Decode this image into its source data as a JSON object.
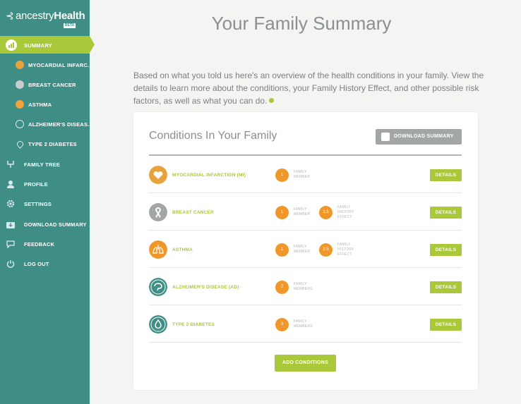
{
  "brand": {
    "name_regular": "ancestry",
    "name_bold": "Health",
    "beta": "BETA"
  },
  "sidebar": {
    "summary": "SUMMARY",
    "sub_items": [
      {
        "label": "MYOCARDIAL INFARC...",
        "icon": "heart-icon",
        "color": "#e8a23b"
      },
      {
        "label": "BREAST CANCER",
        "icon": "ribbon-icon",
        "color": "#a3a6a7"
      },
      {
        "label": "ASTHMA",
        "icon": "lungs-icon",
        "color": "#f0972a"
      },
      {
        "label": "ALZHEIMER'S DISEAS...",
        "icon": "brain-icon",
        "color": "#3f8e86"
      },
      {
        "label": "TYPE 2 DIABETES",
        "icon": "drop-icon",
        "color": "#3f8e86"
      }
    ],
    "items": [
      {
        "label": "FAMILY TREE",
        "icon": "tree-icon"
      },
      {
        "label": "PROFILE",
        "icon": "person-icon"
      },
      {
        "label": "SETTINGS",
        "icon": "gear-icon"
      },
      {
        "label": "DOWNLOAD SUMMARY",
        "icon": "download-icon"
      },
      {
        "label": "FEEDBACK",
        "icon": "chat-icon"
      },
      {
        "label": "LOG OUT",
        "icon": "power-icon"
      }
    ]
  },
  "main": {
    "title": "Your Family Summary",
    "intro": "Based on what you told us here's an overview of the health conditions in your family. View the details to learn more about the conditions, your Family History Effect, and other possible risk factors, as well as what you can do.",
    "card_title": "Conditions In Your Family",
    "download_label": "DOWNLOAD SUMMARY",
    "details_label": "DETAILS",
    "add_label": "ADD CONDITIONS",
    "conditions": [
      {
        "name": "MYOCARDIAL INFARCTION (MI)",
        "members": "1",
        "members_label": "FAMILY MEMBER",
        "effect": null,
        "effect_label": null,
        "icon": "heart-icon",
        "color": "#e8a23b"
      },
      {
        "name": "BREAST CANCER",
        "members": "1",
        "members_label": "FAMILY MEMBER",
        "effect": "1.5",
        "effect_label": "FAMILY HISTORY EFFECT",
        "icon": "ribbon-icon",
        "color": "#a3a6a7"
      },
      {
        "name": "ASTHMA",
        "members": "1",
        "members_label": "FAMILY MEMBER",
        "effect": "2.5",
        "effect_label": "FAMILY HISTORY EFFECT",
        "icon": "lungs-icon",
        "color": "#f0972a"
      },
      {
        "name": "ALZHEIMER'S DISEASE (AD)",
        "members": "2",
        "members_label": "FAMILY MEMBERS",
        "effect": null,
        "effect_label": null,
        "icon": "brain-icon",
        "color": "#3f8e86"
      },
      {
        "name": "TYPE 2 DIABETES",
        "members": "3",
        "members_label": "FAMILY MEMBERS",
        "effect": null,
        "effect_label": null,
        "icon": "drop-icon",
        "color": "#3f8e86"
      }
    ]
  },
  "colors": {
    "sidebar": "#3f8e86",
    "accent": "#a9c83a",
    "badge": "#f0972a"
  }
}
